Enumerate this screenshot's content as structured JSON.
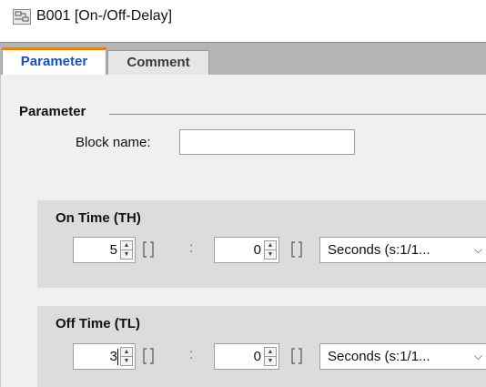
{
  "window": {
    "title": "B001 [On-/Off-Delay]",
    "icon": "logo-block-icon"
  },
  "tabs": [
    {
      "label": "Parameter",
      "active": true
    },
    {
      "label": "Comment",
      "active": false
    }
  ],
  "parameter_section": {
    "title": "Parameter",
    "block_name_label": "Block name:",
    "block_name_value": ""
  },
  "on_time": {
    "title": "On Time (TH)",
    "value1": "5",
    "separator": ":",
    "value2": "0",
    "unit": "Seconds (s:1/1..."
  },
  "off_time": {
    "title": "Off Time (TL)",
    "value1": "3",
    "separator": ":",
    "value2": "0",
    "unit": "Seconds (s:1/1..."
  },
  "colors": {
    "active_tab_text": "#1a4fbf",
    "active_tab_accent": "#e6821e",
    "tabstrip_bg": "#b5b5b5",
    "content_bg": "#f0f0f0",
    "group_bg": "#dcdcdc"
  }
}
